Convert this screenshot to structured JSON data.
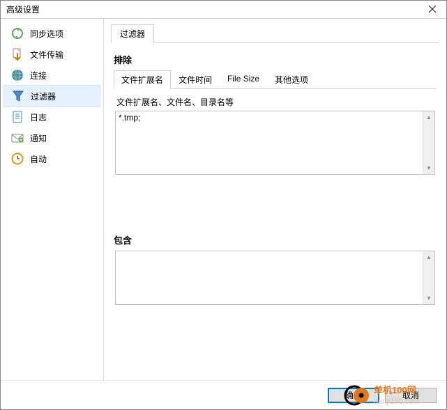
{
  "window": {
    "title": "高级设置"
  },
  "sidebar": {
    "items": [
      {
        "label": "同步选项"
      },
      {
        "label": "文件传输"
      },
      {
        "label": "连接"
      },
      {
        "label": "过滤器"
      },
      {
        "label": "日志"
      },
      {
        "label": "通知"
      },
      {
        "label": "自动"
      }
    ]
  },
  "main": {
    "tab_label": "过滤器",
    "exclude": {
      "title": "排除",
      "tabs": [
        "文件扩展名",
        "文件时间",
        "File Size",
        "其他选项"
      ],
      "field_label": "文件扩展名、文件名、目录名等",
      "value": "*.tmp;"
    },
    "include": {
      "title": "包含",
      "value": ""
    }
  },
  "buttons": {
    "ok": "确定",
    "cancel": "取消"
  },
  "watermark": {
    "line1": "单机100网",
    "line2": "danji100.com"
  }
}
